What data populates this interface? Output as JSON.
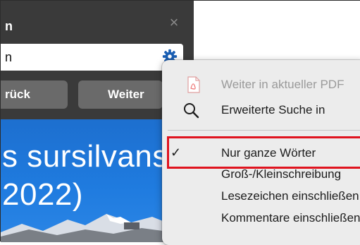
{
  "panel": {
    "title": "n",
    "search_value": "n",
    "back_label": "rück",
    "next_label": "Weiter"
  },
  "preview": {
    "line1": "s sursilvans",
    "line2": "2022)"
  },
  "menu": {
    "items": [
      {
        "label": "Weiter in aktueller PDF",
        "icon": "pdf-icon",
        "enabled": false
      },
      {
        "label": "Erweiterte Suche in",
        "icon": "search-icon",
        "enabled": true
      },
      {
        "label": "Nur ganze Wörter",
        "icon": "checkmark-icon",
        "checked": true,
        "enabled": true
      },
      {
        "label": "Groß-/Kleinschreibung",
        "enabled": true
      },
      {
        "label": "Lesezeichen einschließen",
        "enabled": true
      },
      {
        "label": "Kommentare einschließen",
        "enabled": true
      }
    ]
  },
  "colors": {
    "panel_bg": "#3a3a3a",
    "button_bg": "#6a6a6a",
    "accent_blue": "#1d6fcf",
    "gear_blue": "#1a5fb4",
    "highlight_red": "#e0131e"
  }
}
